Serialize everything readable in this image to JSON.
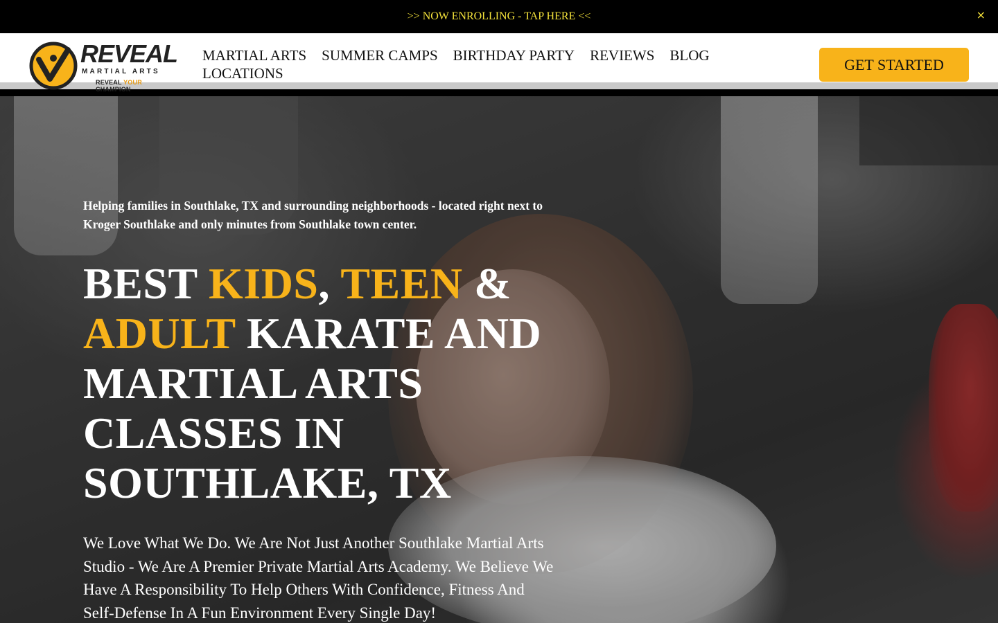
{
  "announcement": {
    "text": ">> NOW ENROLLING - TAP HERE <<",
    "close_glyph": "×"
  },
  "logo": {
    "wordmark": "REVEAL",
    "subtitle": "MARTIAL ARTS",
    "tagline_pre": "REVEAL ",
    "tagline_highlight": "YOUR",
    "tagline_post": " CHAMPION",
    "icon": "check-mark-person-badge"
  },
  "nav": {
    "items": [
      {
        "label": "MARTIAL ARTS"
      },
      {
        "label": "SUMMER CAMPS"
      },
      {
        "label": "BIRTHDAY PARTY"
      },
      {
        "label": "REVIEWS"
      },
      {
        "label": "BLOG"
      },
      {
        "label": "LOCATIONS"
      }
    ]
  },
  "cta": {
    "label": "GET STARTED"
  },
  "hero": {
    "intro": "Helping families in Southlake, TX and surrounding neighborhoods - located right next to Kroger Southlake and only minutes from Southlake town center.",
    "title": {
      "p1": "BEST ",
      "a1": "KIDS",
      "p2": ", ",
      "a2": "TEEN",
      "p3": " & ",
      "a3": "ADULT",
      "p4": " KARATE AND MARTIAL ARTS CLASSES IN SOUTHLAKE, TX"
    },
    "description": "We Love What We Do. We Are Not Just Another Southlake Martial Arts Studio - We Are A Premier Private Martial Arts Academy. We Believe We Have A Responsibility To Help Others With Confidence, Fitness And Self-Defense In A Fun Environment Every Single Day!"
  },
  "colors": {
    "accent": "#f8b31a",
    "announcement_text": "#f5e33b",
    "header_bg": "#ffffff",
    "announcement_bg": "#000000"
  }
}
